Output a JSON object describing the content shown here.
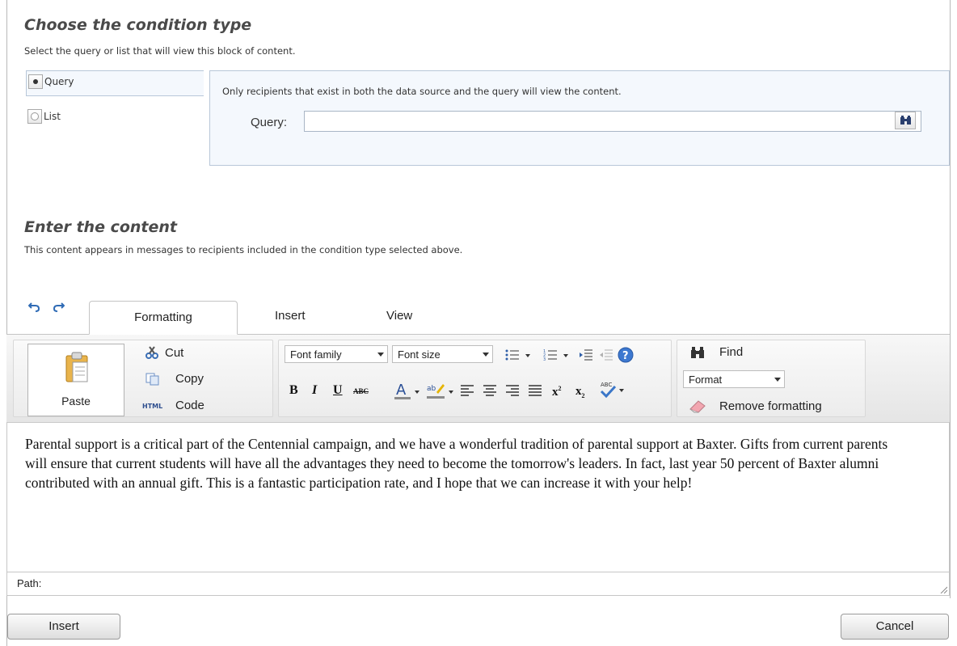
{
  "condition": {
    "title": "Choose the condition type",
    "subtitle": "Select the query or list that will view this block of content.",
    "options": [
      {
        "label": "Query",
        "selected": true
      },
      {
        "label": "List",
        "selected": false
      }
    ],
    "info": "Only recipients that exist in both the data source and the query will view the content.",
    "query_label": "Query:",
    "query_value": ""
  },
  "content": {
    "title": "Enter the content",
    "subtitle": "This content appears in messages to recipients included in the condition type selected above."
  },
  "editor": {
    "tabs": [
      "Formatting",
      "Insert",
      "View"
    ],
    "paste_label": "Paste",
    "cut_label": "Cut",
    "copy_label": "Copy",
    "code_label": "Code",
    "code_prefix": "HTML",
    "font_family": "Font family",
    "font_size": "Font size",
    "find_label": "Find",
    "format_select": "Format",
    "remove_formatting": "Remove formatting",
    "body_text": "Parental support is a critical part of the Centennial campaign, and we have a wonderful tradition of parental support at Baxter. Gifts from current parents will ensure that current students will have all the advantages they need to become the tomorrow's leaders. In fact, last year 50 percent of Baxter alumni contributed with an annual gift. This is a fantastic participation rate, and I hope that we can increase it with your help!",
    "path_label": "Path:"
  },
  "footer": {
    "insert_label": "Insert",
    "cancel_label": "Cancel"
  },
  "colors": {
    "panel_bg": "#f4f8fd",
    "panel_border": "#b8c7d9",
    "heading": "#4a4a4a"
  }
}
